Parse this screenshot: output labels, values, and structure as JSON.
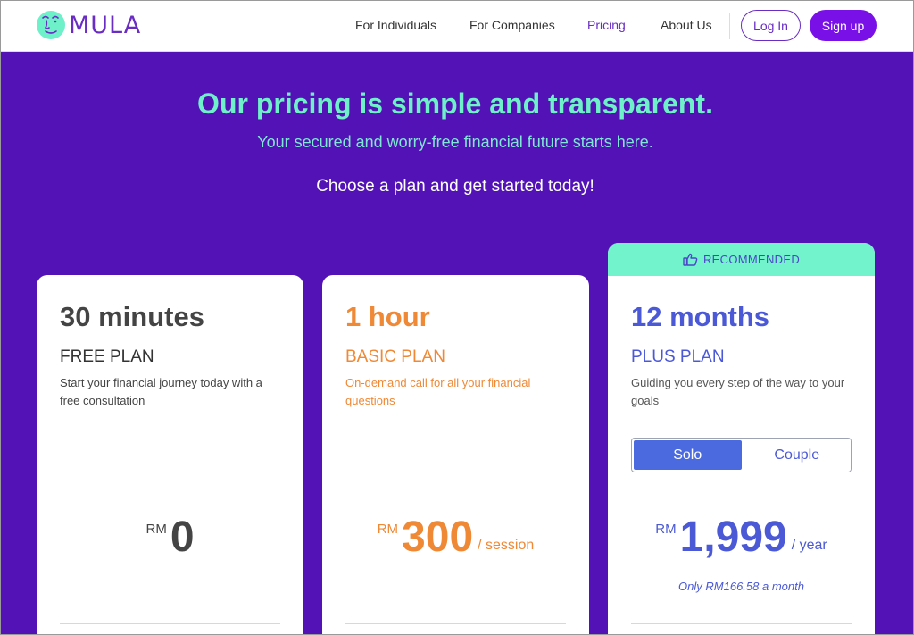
{
  "brand": {
    "name": "MULA"
  },
  "nav": {
    "links": [
      "For Individuals",
      "For Companies",
      "Pricing",
      "About Us"
    ],
    "login": "Log In",
    "signup": "Sign up"
  },
  "hero": {
    "headline": "Our pricing is simple and transparent.",
    "subhead": "Your secured and worry-free financial future starts here.",
    "choose": "Choose a plan and get started today!"
  },
  "plans": [
    {
      "duration": "30 minutes",
      "name": "FREE PLAN",
      "description": "Start your financial journey today with a free consultation",
      "currency": "RM",
      "price": "0",
      "period": ""
    },
    {
      "duration": "1 hour",
      "name": "BASIC PLAN",
      "description": "On-demand call for all your financial questions",
      "currency": "RM",
      "price": "300",
      "period": "/ session"
    },
    {
      "badge": "RECOMMENDED",
      "duration": "12 months",
      "name": "PLUS PLAN",
      "description": "Guiding you every step of the way to your goals",
      "toggle": [
        "Solo",
        "Couple"
      ],
      "toggle_selected": "Solo",
      "currency": "RM",
      "price": "1,999",
      "period": "/ year",
      "monthly_note": "Only RM166.58 a month"
    }
  ],
  "colors": {
    "hero_bg": "#5212b5",
    "brand_purple": "#6a2dc4",
    "signup_bg": "#7a10e8",
    "headline": "#6ef0c8",
    "recommended_banner": "#72f3cb",
    "basic_accent": "#ef8936",
    "plus_accent": "#4b59d6"
  },
  "icons": {
    "logo": "mula-face-logo",
    "recommended": "thumbs-up-icon"
  }
}
